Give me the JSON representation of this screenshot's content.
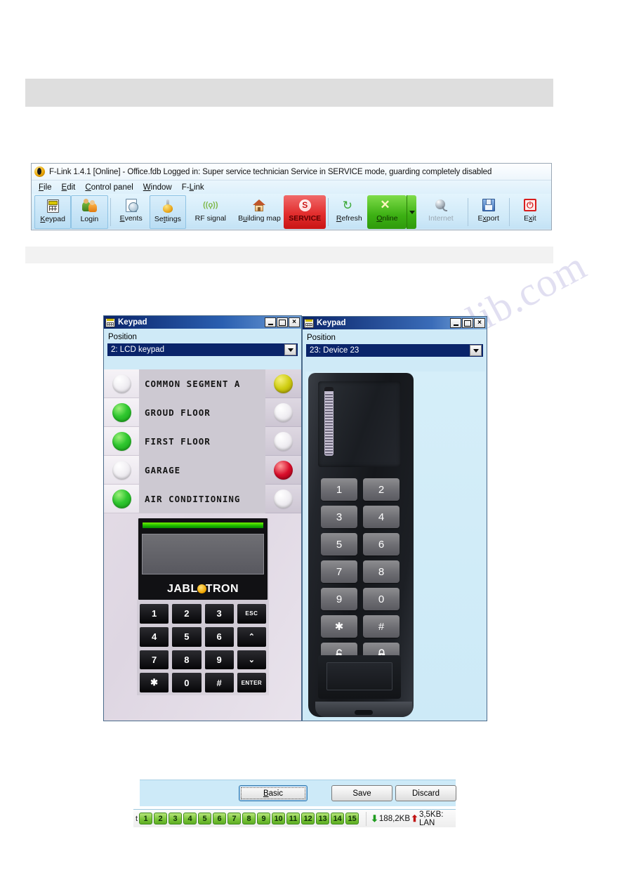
{
  "watermark": {
    "text": "manualslib.com"
  },
  "app": {
    "title": "F-Link 1.4.1 [Online] - Office.fdb Logged in: Super service technician Service in SERVICE mode, guarding completely disabled",
    "logo_icon": "jablotron-logo-icon",
    "menu": [
      {
        "pre": "",
        "accel": "F",
        "post": "ile"
      },
      {
        "pre": "",
        "accel": "E",
        "post": "dit"
      },
      {
        "pre": "",
        "accel": "C",
        "post": "ontrol panel"
      },
      {
        "pre": "",
        "accel": "W",
        "post": "indow"
      },
      {
        "pre": "F-",
        "accel": "L",
        "post": "ink"
      }
    ],
    "toolbar": [
      {
        "id": "keypad",
        "pre": "",
        "accel": "K",
        "post": "eypad",
        "icon": "keypad-icon",
        "state": "highlighted"
      },
      {
        "id": "login",
        "pre": "Lo",
        "accel": "",
        "post": "gin",
        "icon": "login-users-icon",
        "state": "highlighted"
      },
      {
        "id": "events",
        "pre": "",
        "accel": "E",
        "post": "vents",
        "icon": "events-report-icon",
        "state": "normal"
      },
      {
        "id": "settings",
        "pre": "Se",
        "accel": "t",
        "post": "tings",
        "icon": "settings-gear-icon",
        "state": "highlighted"
      },
      {
        "id": "rf-signal",
        "pre": "RF signal",
        "accel": "",
        "post": "",
        "icon": "rf-antenna-icon",
        "state": "normal"
      },
      {
        "id": "building-map",
        "pre": "B",
        "accel": "u",
        "post": "ilding map",
        "icon": "house-icon",
        "state": "normal"
      },
      {
        "id": "service",
        "pre": "SERVICE",
        "accel": "",
        "post": "",
        "icon": "service-s-icon",
        "state": "service"
      },
      {
        "id": "refresh",
        "pre": "",
        "accel": "R",
        "post": "efresh",
        "icon": "refresh-icon",
        "state": "normal"
      },
      {
        "id": "online",
        "pre": "",
        "accel": "O",
        "post": "nline",
        "icon": "online-x-icon",
        "state": "online"
      },
      {
        "id": "internet",
        "pre": "Internet",
        "accel": "",
        "post": "",
        "icon": "internet-mouse-icon",
        "state": "disabled"
      },
      {
        "id": "export",
        "pre": "E",
        "accel": "x",
        "post": "port",
        "icon": "save-floppy-icon",
        "state": "normal"
      },
      {
        "id": "exit",
        "pre": "E",
        "accel": "x",
        "post": "it",
        "icon": "exit-power-icon",
        "state": "normal"
      }
    ]
  },
  "keypad_left": {
    "window_title": "Keypad",
    "window_icon": "keypad-icon",
    "titlebar_buttons": {
      "minimize": "minimize-icon",
      "maximize": "maximize-icon",
      "close": "×"
    },
    "position_label": "Position",
    "position_value": "2: LCD keypad",
    "dropdown_icon": "chevron-down-icon",
    "segments": [
      {
        "name": "COMMON SEGMENT A",
        "left_led": "off",
        "right_led": "yellow"
      },
      {
        "name": "GROUD FLOOR",
        "left_led": "green",
        "right_led": "off"
      },
      {
        "name": "FIRST FLOOR",
        "left_led": "green",
        "right_led": "off"
      },
      {
        "name": "GARAGE",
        "left_led": "off",
        "right_led": "red"
      },
      {
        "name": "AIR CONDITIONING",
        "left_led": "green",
        "right_led": "off"
      }
    ],
    "device": {
      "brand": "JABL",
      "brand_tail": "TRON",
      "keys": [
        "1",
        "2",
        "3",
        "ESC",
        "4",
        "5",
        "6",
        "⌃",
        "7",
        "8",
        "9",
        "⌄",
        "✱",
        "0",
        "#",
        "ENTER"
      ]
    }
  },
  "keypad_right": {
    "window_title": "Keypad",
    "window_icon": "keypad-icon",
    "titlebar_buttons": {
      "minimize": "minimize-icon",
      "maximize": "maximize-icon",
      "close": "×"
    },
    "position_label": "Position",
    "position_value": "23: Device 23",
    "dropdown_icon": "chevron-down-icon",
    "device": {
      "keys": [
        "1",
        "2",
        "3",
        "4",
        "5",
        "6",
        "7",
        "8",
        "9",
        "0",
        "✱",
        "#"
      ],
      "lock_keys": [
        "unlock-icon",
        "lock-icon"
      ]
    }
  },
  "dialog_buttons": {
    "basic": {
      "pre": "",
      "accel": "B",
      "post": "asic"
    },
    "save": "Save",
    "discard": "Discard"
  },
  "status_bar": {
    "leading_letter": "t",
    "segments": [
      "1",
      "2",
      "3",
      "4",
      "5",
      "6",
      "7",
      "8",
      "9",
      "10",
      "11",
      "12",
      "13",
      "14",
      "15"
    ],
    "download_icon": "arrow-down-icon",
    "download": "188,2KB",
    "upload_icon": "arrow-up-icon",
    "upload": "3,5KB: LAN"
  },
  "colors": {
    "service_red": "#e22e2e",
    "online_green": "#3cb013",
    "titlebar_blue": "#0a246a",
    "window_bg": "#cfeaf7",
    "led_green": "#2fc72f",
    "led_yellow": "#cfcd10",
    "led_red": "#d80d2a"
  }
}
